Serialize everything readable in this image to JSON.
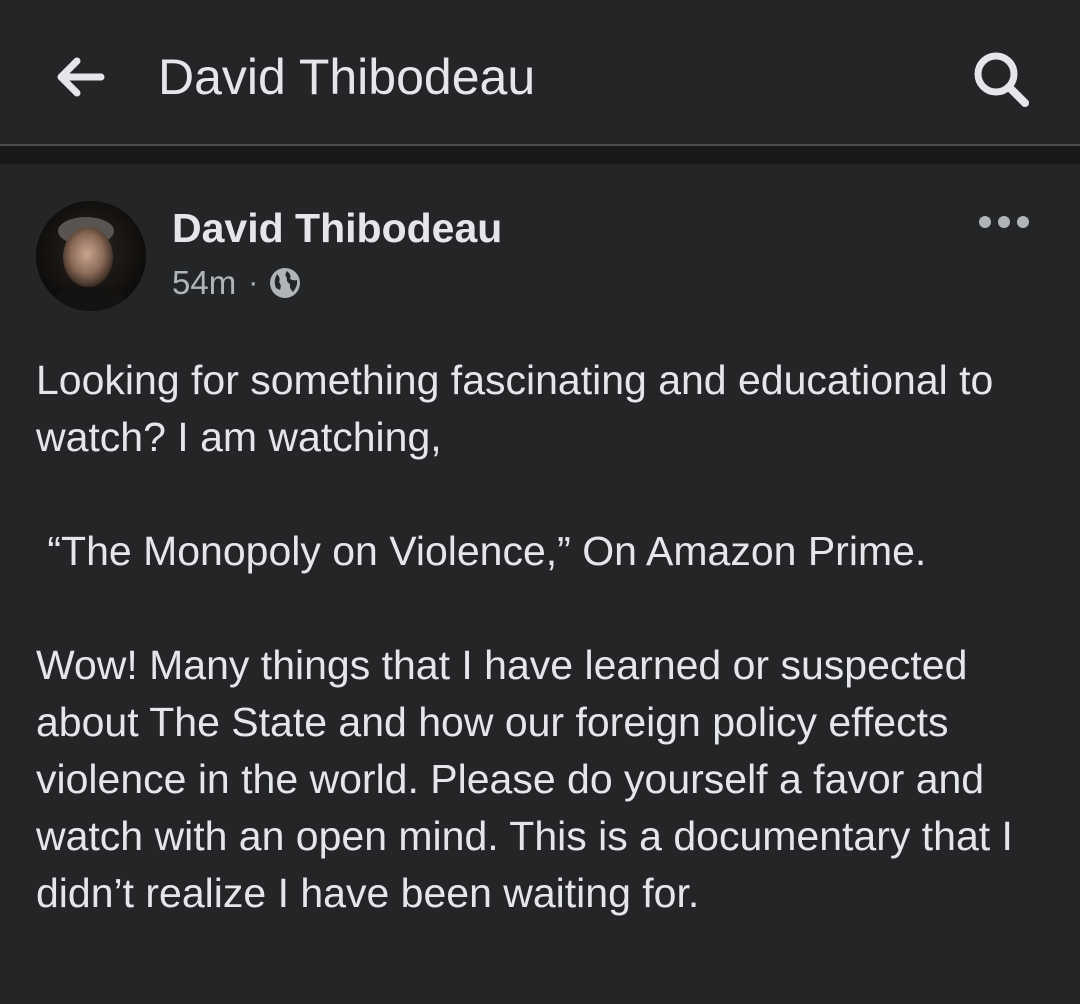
{
  "app_bar": {
    "title": "David Thibodeau",
    "back_icon": "arrow-left-icon",
    "search_icon": "search-icon"
  },
  "post": {
    "author_name": "David Thibodeau",
    "timestamp": "54m",
    "separator": "·",
    "privacy_icon": "globe-icon",
    "more_icon": "more-horizontal-icon",
    "body": {
      "paragraph_1": "Looking for something fascinating and educational to watch? I am watching,",
      "paragraph_2": " “The Monopoly on Violence,” On Amazon Prime.",
      "paragraph_3": "Wow! Many things that I have learned or suspected about The State and how our foreign policy effects violence in the world. Please do yourself a favor and watch with an open mind. This is a documentary that I didn’t realize I have been waiting for."
    }
  },
  "colors": {
    "background": "#242526",
    "divider_band": "#18191a",
    "primary_text": "#e4e6eb",
    "secondary_text": "#b0b3b8"
  }
}
